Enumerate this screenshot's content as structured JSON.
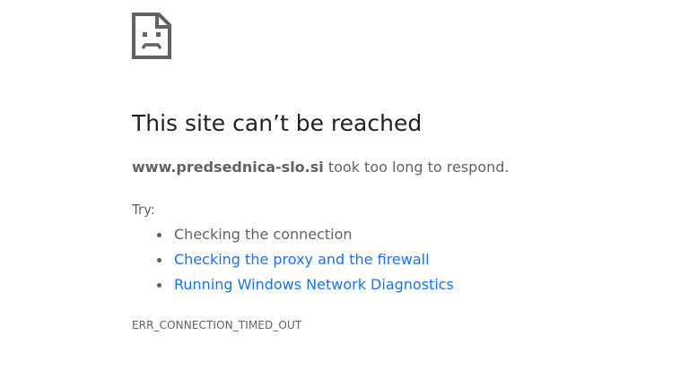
{
  "icon": {
    "name": "sad-page-icon",
    "color": "#5f6368"
  },
  "title": "This site can’t be reached",
  "message": {
    "domain": "www.predsednica-slo.si",
    "text": " took too long to respond."
  },
  "try_label": "Try:",
  "suggestions": [
    {
      "label": "Checking the connection",
      "is_link": false
    },
    {
      "label": "Checking the proxy and the firewall",
      "is_link": true
    },
    {
      "label": "Running Windows Network Diagnostics",
      "is_link": true
    }
  ],
  "error_code": "ERR_CONNECTION_TIMED_OUT",
  "colors": {
    "title": "#202124",
    "text": "#5f6368",
    "link": "#1a73e8",
    "background": "#ffffff"
  }
}
